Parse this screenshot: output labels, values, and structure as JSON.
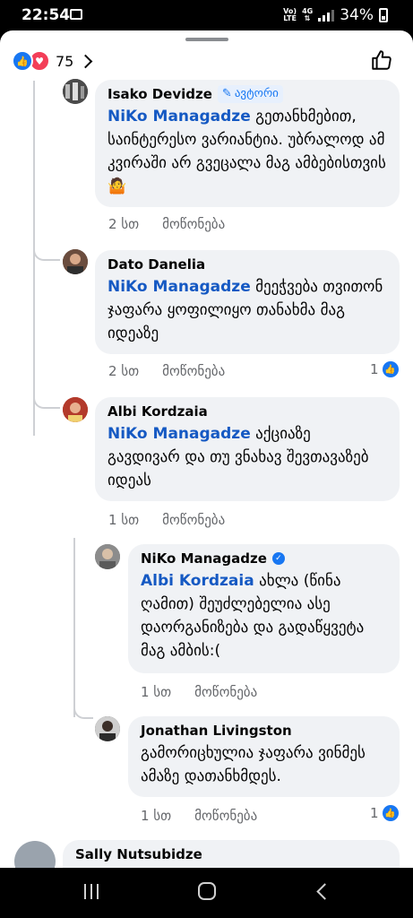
{
  "status_bar": {
    "time": "22:54",
    "network_top": "Vo)",
    "network_mid": "LTE",
    "network_type": "4G",
    "battery": "34%"
  },
  "reactions": {
    "count": "75"
  },
  "comments": [
    {
      "author": "Isako Devidze",
      "badge": "ავტორი",
      "mention": "NiKo Managadze",
      "text": " გეთანხმებით, საინტერესო ვარიანტია. უბრალოდ ამ კვირაში არ გვეცალა მაგ ამბებისთვის 🤷",
      "time": "2 სთ",
      "like_label": "მოწონება"
    },
    {
      "author": "Dato Danelia",
      "mention": "NiKo Managadze",
      "text": " მეეჭვება თვითონ ჯაფარა ყოფილიყო თანახმა მაგ იდეაზე",
      "time": "2 სთ",
      "like_label": "მოწონება",
      "likes": "1"
    },
    {
      "author": "Albi Kordzaia",
      "mention": "NiKo Managadze",
      "text": " აქციაზე გავდივარ და თუ ვნახავ შევთავაზებ იდეას",
      "time": "1 სთ",
      "like_label": "მოწონება"
    },
    {
      "author": "NiKo Managadze",
      "mention": "Albi Kordzaia",
      "text": " ახლა (წინა ღამით) შეუძლებელია ასე დაორგანიზება და გადაწყვეტა მაგ ამბის:(",
      "time": "1 სთ",
      "like_label": "მოწონება"
    },
    {
      "author": "Jonathan Livingston",
      "text": "გამორიცხულია ჯაფარა ვინმეს ამაზე დათანხმდეს.",
      "time": "1 სთ",
      "like_label": "მოწონება",
      "likes": "1"
    },
    {
      "author": "Sally Nutsubidze"
    }
  ],
  "colors": {
    "accent": "#1877f2",
    "mention": "#1559c3",
    "bubble": "#f0f2f5",
    "meta": "#65676b"
  }
}
